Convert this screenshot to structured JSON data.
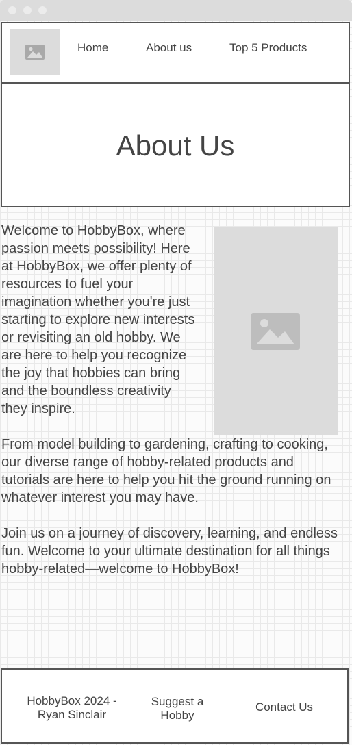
{
  "nav": {
    "logo_icon": "image-placeholder-icon",
    "items": [
      "Home",
      "About us",
      "Top 5 Products"
    ]
  },
  "hero": {
    "title": "About Us"
  },
  "content": {
    "image_icon": "image-placeholder-icon",
    "paragraphs": [
      "Welcome to HobbyBox, where passion meets possibility! Here at HobbyBox, we offer plenty of resources to fuel your imagination whether you're just starting to explore new interests or revisiting an old hobby. We are here to help you recognize the joy that hobbies can bring and the boundless creativity they inspire.",
      "From model building to gardening, crafting to cooking, our diverse range of hobby-related products and tutorials are here to help you hit the ground running on whatever interest you may have.",
      "Join us on a journey of discovery, learning, and endless fun. Welcome to your ultimate destination for all things hobby-related—welcome to HobbyBox!"
    ]
  },
  "footer": {
    "copyright": "HobbyBox 2024 - Ryan Sinclair",
    "suggest": "Suggest a Hobby",
    "contact": "Contact Us"
  },
  "colors": {
    "placeholder_gray": "#dcdcdc",
    "border": "#555555",
    "text": "#444444",
    "titlebar": "#dcdcdc"
  }
}
